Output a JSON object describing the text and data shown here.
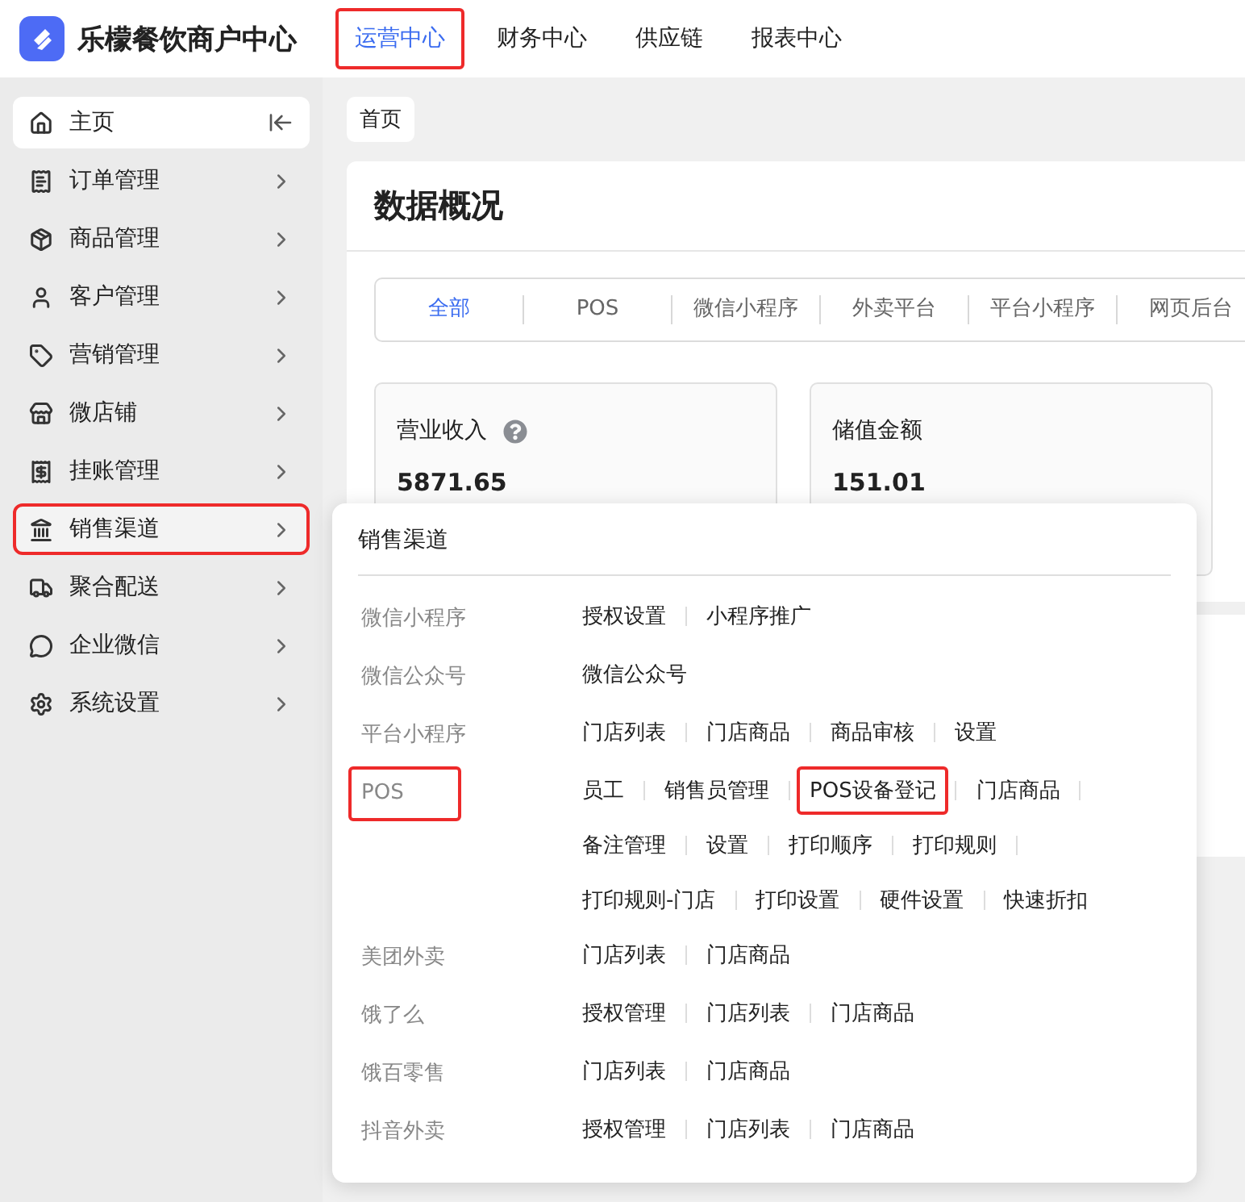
{
  "brand": {
    "name": "乐檬餐饮商户中心"
  },
  "top_nav": [
    {
      "label": "运营中心",
      "selected": true,
      "highlighted": true
    },
    {
      "label": "财务中心",
      "selected": false,
      "highlighted": false
    },
    {
      "label": "供应链",
      "selected": false,
      "highlighted": false
    },
    {
      "label": "报表中心",
      "selected": false,
      "highlighted": false
    }
  ],
  "sidebar": {
    "items": [
      {
        "kind": "home",
        "label": "主页",
        "selected": true,
        "highlighted": false
      },
      {
        "kind": "orders",
        "label": "订单管理",
        "selected": false,
        "highlighted": false
      },
      {
        "kind": "goods",
        "label": "商品管理",
        "selected": false,
        "highlighted": false
      },
      {
        "kind": "customers",
        "label": "客户管理",
        "selected": false,
        "highlighted": false
      },
      {
        "kind": "marketing",
        "label": "营销管理",
        "selected": false,
        "highlighted": false
      },
      {
        "kind": "shop",
        "label": "微店铺",
        "selected": false,
        "highlighted": false
      },
      {
        "kind": "credit",
        "label": "挂账管理",
        "selected": false,
        "highlighted": false
      },
      {
        "kind": "channels",
        "label": "销售渠道",
        "selected": false,
        "highlighted": true
      },
      {
        "kind": "delivery",
        "label": "聚合配送",
        "selected": false,
        "highlighted": false
      },
      {
        "kind": "wecom",
        "label": "企业微信",
        "selected": false,
        "highlighted": false
      },
      {
        "kind": "settings",
        "label": "系统设置",
        "selected": false,
        "highlighted": false
      }
    ]
  },
  "breadcrumb": [
    "首页"
  ],
  "overview": {
    "title": "数据概况",
    "tabs": [
      {
        "label": "全部",
        "selected": true
      },
      {
        "label": "POS",
        "selected": false
      },
      {
        "label": "微信小程序",
        "selected": false
      },
      {
        "label": "外卖平台",
        "selected": false
      },
      {
        "label": "平台小程序",
        "selected": false
      },
      {
        "label": "网页后台",
        "selected": false
      }
    ],
    "stats": [
      {
        "label": "营业收入",
        "value": "5871.65",
        "help": true
      },
      {
        "label": "储值金额",
        "value": "151.01",
        "help": false
      }
    ]
  },
  "channel_menu": {
    "title": "销售渠道",
    "rows": [
      {
        "label": "微信小程序",
        "highlighted": false,
        "lines": [
          [
            {
              "label": "授权设置",
              "highlighted": false
            },
            {
              "label": "小程序推广",
              "highlighted": false
            }
          ]
        ]
      },
      {
        "label": "微信公众号",
        "highlighted": false,
        "lines": [
          [
            {
              "label": "微信公众号",
              "highlighted": false
            }
          ]
        ]
      },
      {
        "label": "平台小程序",
        "highlighted": false,
        "lines": [
          [
            {
              "label": "门店列表",
              "highlighted": false
            },
            {
              "label": "门店商品",
              "highlighted": false
            },
            {
              "label": "商品审核",
              "highlighted": false
            },
            {
              "label": "设置",
              "highlighted": false
            }
          ]
        ]
      },
      {
        "label": "POS",
        "highlighted": true,
        "lines": [
          [
            {
              "label": "员工",
              "highlighted": false
            },
            {
              "label": "销售员管理",
              "highlighted": false
            },
            {
              "label": "POS设备登记",
              "highlighted": true
            },
            {
              "label": "门店商品",
              "highlighted": false
            }
          ],
          [
            {
              "label": "备注管理",
              "highlighted": false
            },
            {
              "label": "设置",
              "highlighted": false
            },
            {
              "label": "打印顺序",
              "highlighted": false
            },
            {
              "label": "打印规则",
              "highlighted": false
            }
          ],
          [
            {
              "label": "打印规则-门店",
              "highlighted": false
            },
            {
              "label": "打印设置",
              "highlighted": false
            },
            {
              "label": "硬件设置",
              "highlighted": false
            },
            {
              "label": "快速折扣",
              "highlighted": false
            }
          ]
        ]
      },
      {
        "label": "美团外卖",
        "highlighted": false,
        "lines": [
          [
            {
              "label": "门店列表",
              "highlighted": false
            },
            {
              "label": "门店商品",
              "highlighted": false
            }
          ]
        ]
      },
      {
        "label": "饿了么",
        "highlighted": false,
        "lines": [
          [
            {
              "label": "授权管理",
              "highlighted": false
            },
            {
              "label": "门店列表",
              "highlighted": false
            },
            {
              "label": "门店商品",
              "highlighted": false
            }
          ]
        ]
      },
      {
        "label": "饿百零售",
        "highlighted": false,
        "lines": [
          [
            {
              "label": "门店列表",
              "highlighted": false
            },
            {
              "label": "门店商品",
              "highlighted": false
            }
          ]
        ]
      },
      {
        "label": "抖音外卖",
        "highlighted": false,
        "lines": [
          [
            {
              "label": "授权管理",
              "highlighted": false
            },
            {
              "label": "门店列表",
              "highlighted": false
            },
            {
              "label": "门店商品",
              "highlighted": false
            }
          ]
        ]
      }
    ]
  }
}
